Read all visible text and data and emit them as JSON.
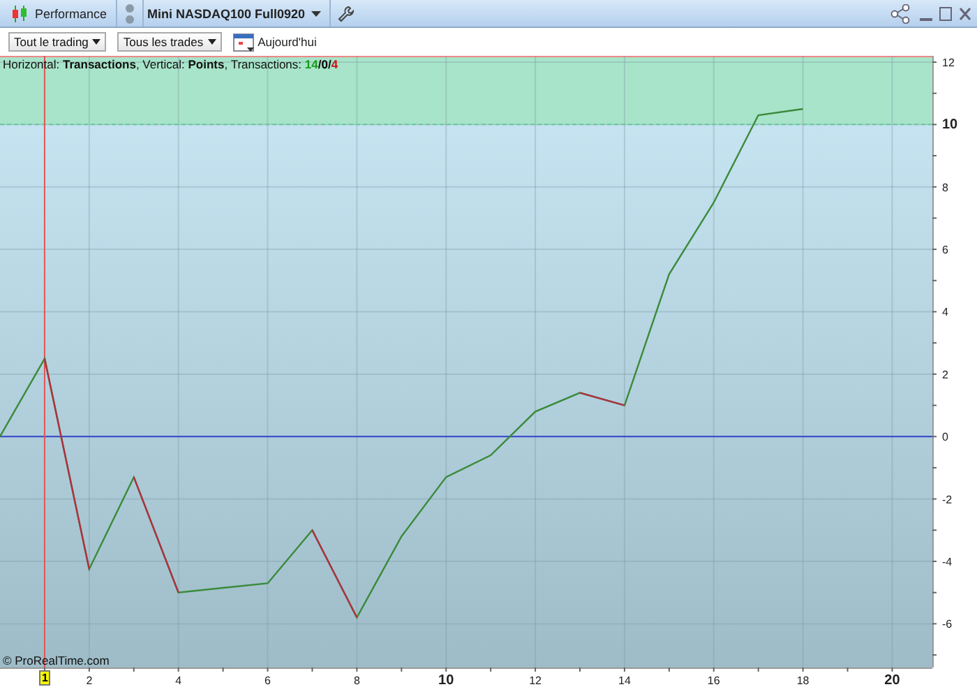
{
  "window": {
    "tabs": [
      {
        "label": "Performance",
        "selected": false
      },
      {
        "label": "Mini NASDAQ100 Full0920",
        "selected": true
      }
    ]
  },
  "toolbar": {
    "dropdowns": [
      "Tout le trading",
      "Tous les trades"
    ],
    "date_button": "Aujourd'hui"
  },
  "chart": {
    "info": {
      "text": "Horizontal: **Transactions**, Vertical: **Points**, Transactions:",
      "counts": [
        {
          "value": "14",
          "color": "#1c9a1c"
        },
        {
          "value": "0",
          "color": "#000000"
        },
        {
          "value": "4",
          "color": "#cc1111"
        }
      ],
      "separator": "/"
    },
    "copyright": "© ProRealTime.com",
    "chart_data": {
      "type": "line",
      "x": [
        0,
        1,
        2,
        3,
        4,
        5,
        6,
        7,
        8,
        9,
        10,
        11,
        12,
        13,
        14,
        15,
        16,
        17,
        18
      ],
      "series": [
        {
          "color": "#3a8a3a",
          "values": [
            0,
            2.5,
            -4.25,
            -1.3,
            -5.0,
            -4.85,
            -4.7,
            -3.0,
            -5.8,
            -3.2,
            -1.3,
            -0.6,
            0.8,
            1.4,
            1.0,
            5.2,
            7.5,
            10.3,
            10.5
          ]
        }
      ],
      "xlim": [
        0,
        20.9
      ],
      "ylim": [
        -7.4,
        12.2
      ],
      "xticks": [
        2,
        4,
        6,
        8,
        {
          "value": 10,
          "label": "10"
        },
        12,
        14,
        16,
        18,
        {
          "value": 20,
          "label": "20"
        }
      ],
      "yticks": [
        12,
        {
          "value": 10,
          "label": "10"
        },
        8,
        6,
        4,
        2,
        0,
        -2,
        -4,
        -6
      ],
      "grid": true,
      "bands": [
        {
          "axis": "y",
          "from": 10,
          "to": 12.2,
          "color": "#a8e4c9"
        }
      ],
      "ref_lines": [
        {
          "axis": "y",
          "value": 10,
          "color": "#66cc99"
        },
        {
          "axis": "y",
          "value": 0,
          "color": "#3344cc"
        },
        {
          "axis": "x",
          "value": 1,
          "label": "1",
          "color": "#e05555"
        }
      ]
    }
  }
}
